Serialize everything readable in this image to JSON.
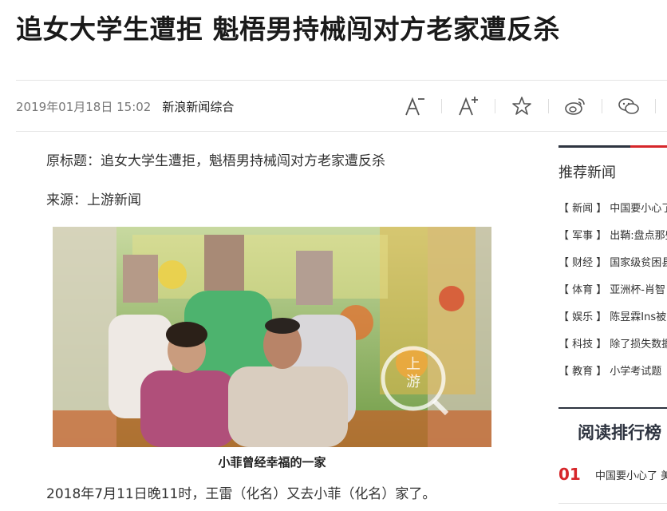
{
  "article": {
    "headline": "追女大学生遭拒 魁梧男持械闯对方老家遭反杀",
    "date": "2019年01月18日 15:02",
    "source": "新浪新闻综合",
    "para_original_title": "原标题：追女大学生遭拒，魁梧男持械闯对方老家遭反杀",
    "para_source": "来源：上游新闻",
    "photo_caption": "小菲曾经幸福的一家",
    "photo_watermark_line1": "上",
    "photo_watermark_line2": "游",
    "para_body_1": "2018年7月11日晚11时，王雷（化名）又去小菲（化名）家了。"
  },
  "toolbar": {
    "icons": [
      "font-decrease-icon",
      "font-increase-icon",
      "star-icon",
      "weibo-icon",
      "wechat-icon",
      "share-icon"
    ]
  },
  "sidebar": {
    "title": "推荐新闻",
    "items": [
      {
        "tag": "【 新闻 】",
        "text": "中国要小心了"
      },
      {
        "tag": "【 军事 】",
        "text": "出鞘:盘点那些"
      },
      {
        "tag": "【 财经 】",
        "text": "国家级贫困县"
      },
      {
        "tag": "【 体育 】",
        "text": "亚洲杯-肖智"
      },
      {
        "tag": "【 娱乐 】",
        "text": "陈昱霖Ins被"
      },
      {
        "tag": "【 科技 】",
        "text": "除了损失数据"
      },
      {
        "tag": "【 教育 】",
        "text": "小学考试题"
      }
    ]
  },
  "ranking": {
    "title": "阅读排行榜",
    "items": [
      {
        "num": "01",
        "text": "中国要小心了 美"
      }
    ]
  },
  "colors": {
    "accent_red": "#d6262a",
    "dark_navy": "#2e3440"
  }
}
